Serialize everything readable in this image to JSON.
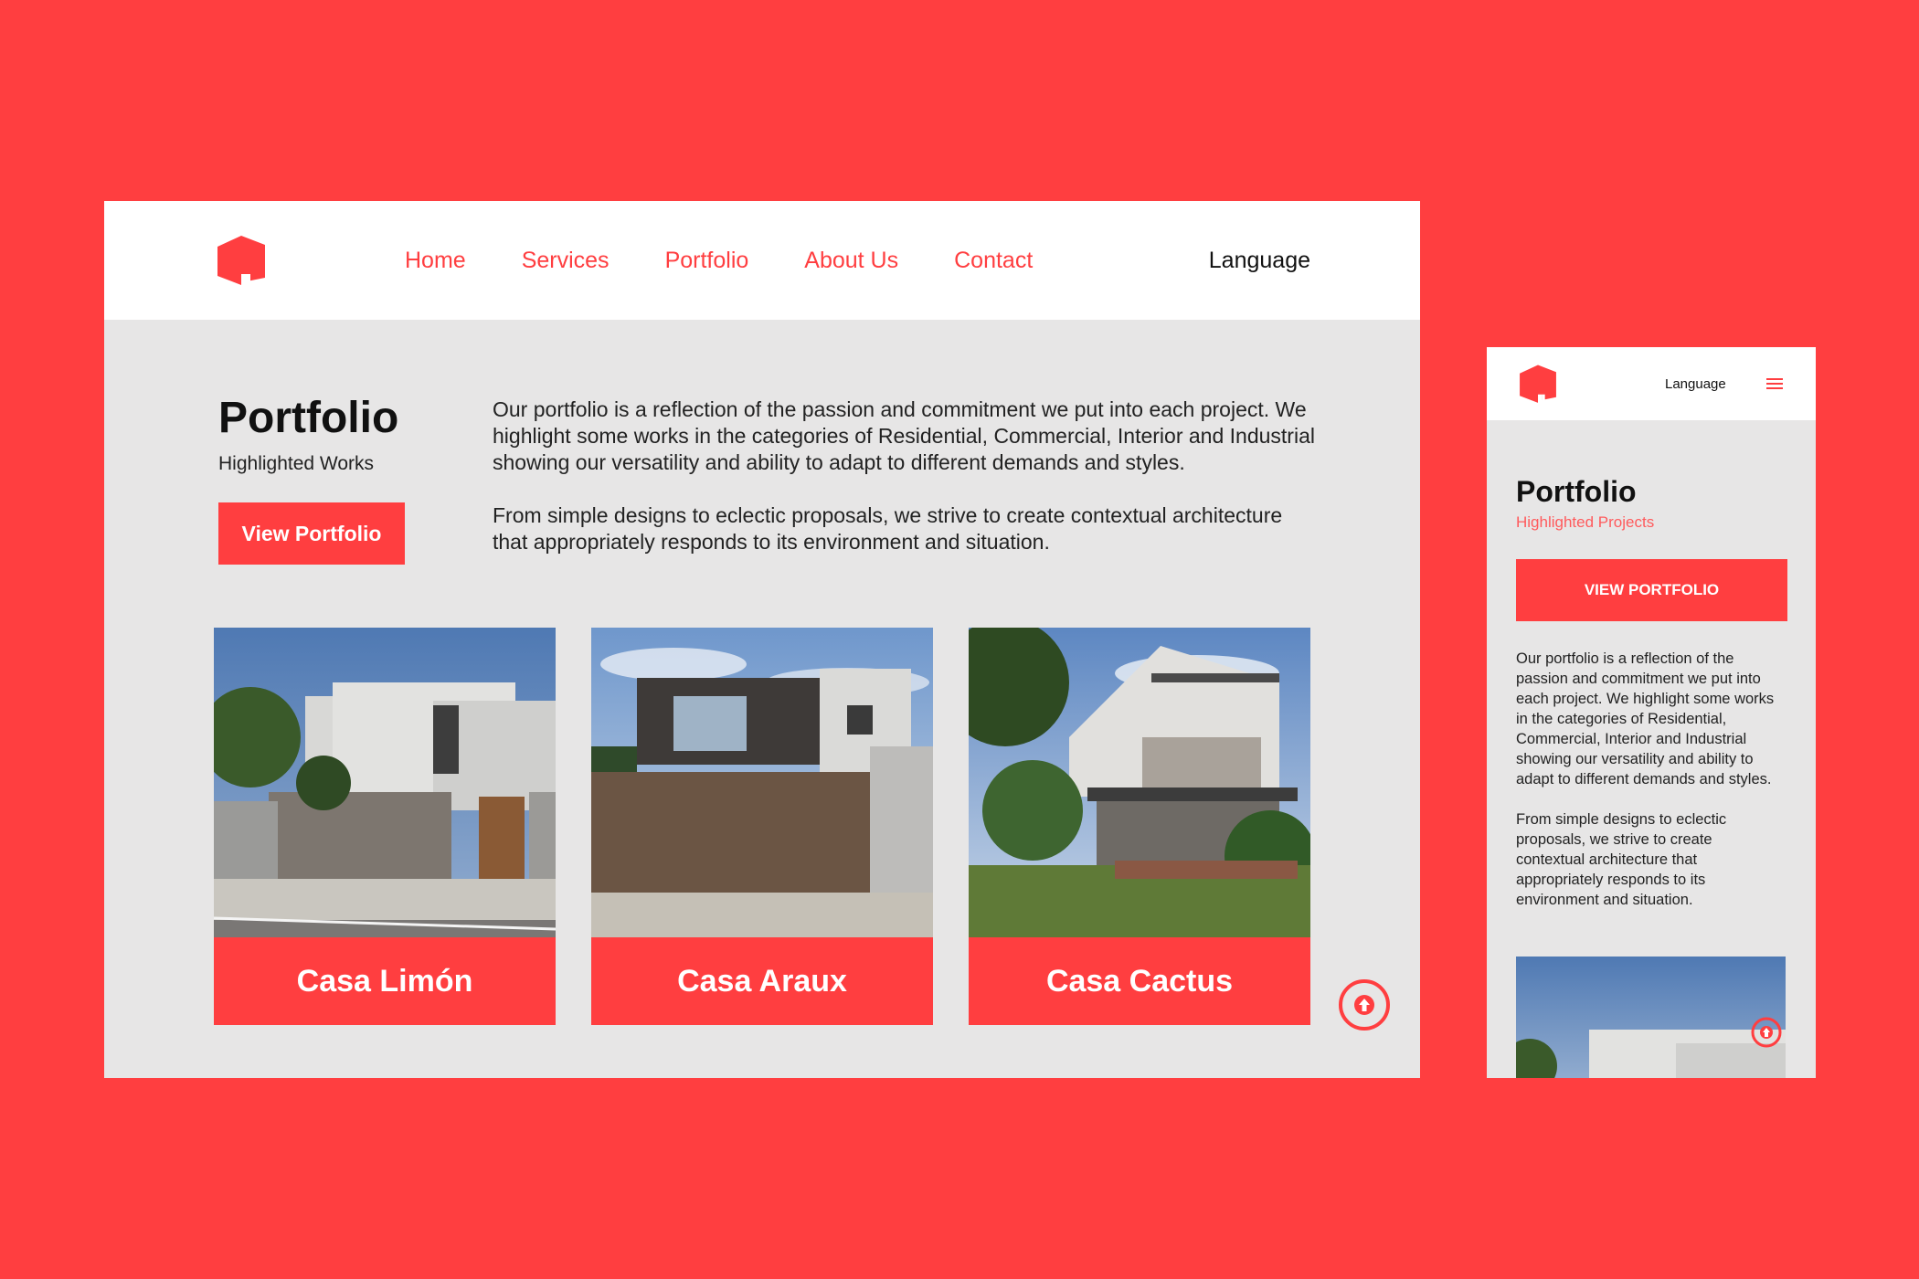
{
  "colors": {
    "accent": "#ff3e40",
    "panel": "#e7e6e6",
    "header": "#ffffff",
    "text": "#111111"
  },
  "desktop": {
    "logo_icon": "house-logo-icon",
    "nav": [
      "Home",
      "Services",
      "Portfolio",
      "About Us",
      "Contact"
    ],
    "language": "Language",
    "title": "Portfolio",
    "subtitle": "Highlighted Works",
    "button": "View Portfolio",
    "paragraphs": [
      "Our portfolio is a reflection of the passion and commitment we put into each project. We highlight some works in the categories of Residential, Commercial, Interior and Industrial showing our versatility and ability to adapt to different demands and styles.",
      "From simple designs to eclectic proposals, we strive to create contextual architecture that appropriately responds to its environment and situation."
    ],
    "projects": [
      {
        "name": "Casa Limón"
      },
      {
        "name": "Casa Araux"
      },
      {
        "name": "Casa Cactus"
      }
    ],
    "scroll_top_icon": "arrow-up-circle-icon"
  },
  "mobile": {
    "logo_icon": "house-logo-icon",
    "language": "Language",
    "menu_icon": "hamburger-menu-icon",
    "title": "Portfolio",
    "subtitle": "Highlighted Projects",
    "button": "VIEW PORTFOLIO",
    "paragraphs": [
      "Our portfolio is a reflection of the passion and commitment we put into each project. We highlight some works in the categories of Residential, Commercial, Interior and Industrial showing our versatility and ability to adapt to different demands and styles.",
      "From simple designs to eclectic proposals, we strive to create contextual architecture that appropriately responds to its environment and situation."
    ],
    "scroll_top_icon": "arrow-up-circle-icon"
  }
}
